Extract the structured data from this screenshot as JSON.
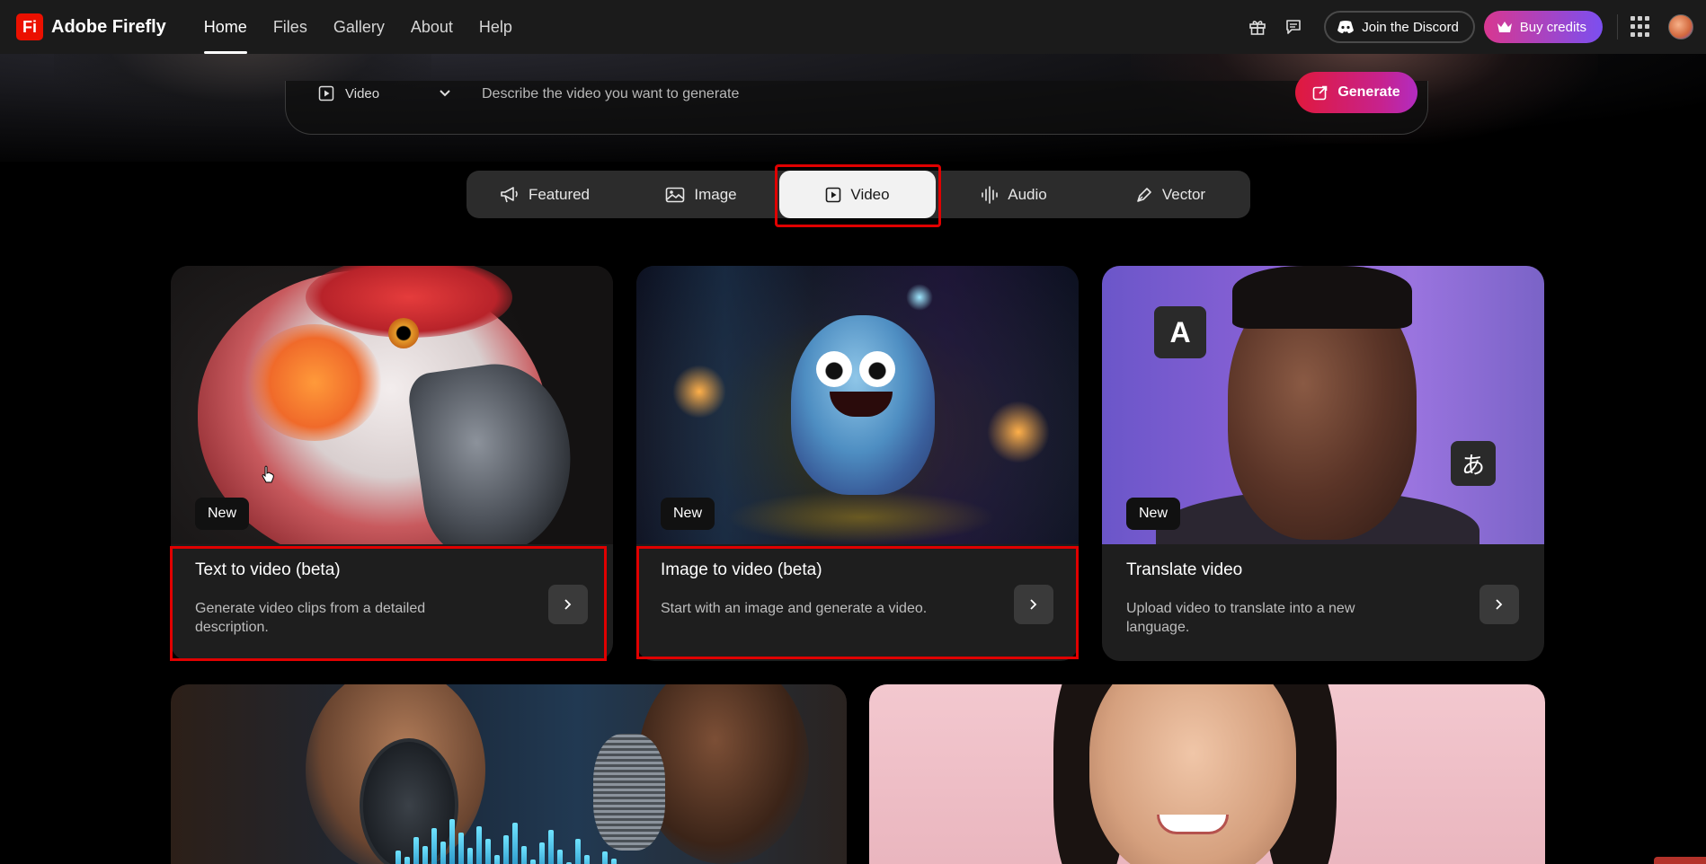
{
  "app": {
    "logo_mark": "Fi",
    "name": "Adobe Firefly"
  },
  "nav": {
    "items": [
      {
        "label": "Home",
        "active": true
      },
      {
        "label": "Files",
        "active": false
      },
      {
        "label": "Gallery",
        "active": false
      },
      {
        "label": "About",
        "active": false
      },
      {
        "label": "Help",
        "active": false
      }
    ],
    "discord_label": "Join the Discord",
    "credits_label": "Buy credits"
  },
  "prompt": {
    "mode_label": "Video",
    "placeholder": "Describe the video you want to generate",
    "generate_label": "Generate"
  },
  "tabs": [
    {
      "label": "Featured",
      "icon": "megaphone-icon",
      "selected": false
    },
    {
      "label": "Image",
      "icon": "image-icon",
      "selected": false
    },
    {
      "label": "Video",
      "icon": "video-icon",
      "selected": true
    },
    {
      "label": "Audio",
      "icon": "audio-waveform-icon",
      "selected": false
    },
    {
      "label": "Vector",
      "icon": "pen-icon",
      "selected": false
    }
  ],
  "cards": [
    {
      "badge": "New",
      "title": "Text to video (beta)",
      "description": "Generate video clips from a detailed description."
    },
    {
      "badge": "New",
      "title": "Image to video (beta)",
      "description": "Start with an image and generate a video."
    },
    {
      "badge": "New",
      "title": "Translate video",
      "description": "Upload video to translate into a new language.",
      "bubble_a": "A",
      "bubble_b": "あ"
    }
  ],
  "colors": {
    "accent_red": "#e00000",
    "adobe_red": "#eb1000",
    "credits_gradient_start": "#d83790",
    "credits_gradient_end": "#7b4ff0"
  }
}
